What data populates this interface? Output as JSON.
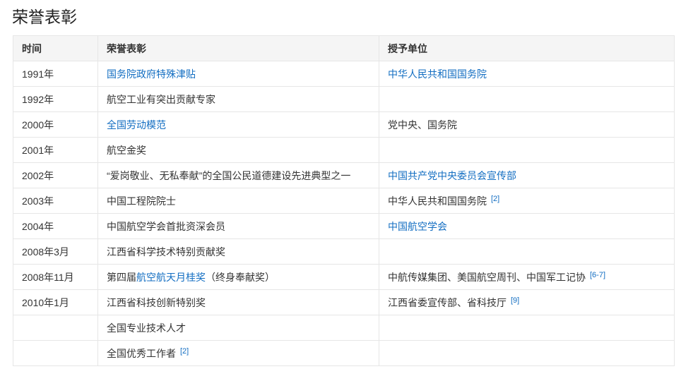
{
  "title": "荣誉表彰",
  "headers": [
    "时间",
    "荣誉表彰",
    "授予单位"
  ],
  "rows": [
    {
      "time": "1991年",
      "honor": [
        {
          "text": "国务院政府特殊津贴",
          "link": true
        }
      ],
      "org": [
        {
          "text": "中华人民共和国国务院",
          "link": true
        }
      ],
      "org_ref": ""
    },
    {
      "time": "1992年",
      "honor": [
        {
          "text": "航空工业有突出贡献专家",
          "link": false
        }
      ],
      "org": [],
      "org_ref": ""
    },
    {
      "time": "2000年",
      "honor": [
        {
          "text": "全国劳动模范",
          "link": true
        }
      ],
      "org": [
        {
          "text": "党中央、国务院",
          "link": false
        }
      ],
      "org_ref": ""
    },
    {
      "time": "2001年",
      "honor": [
        {
          "text": "航空金奖",
          "link": false
        }
      ],
      "org": [],
      "org_ref": ""
    },
    {
      "time": "2002年",
      "honor": [
        {
          "text": "“爱岗敬业、无私奉献”的全国公民道德建设先进典型之一",
          "link": false
        }
      ],
      "org": [
        {
          "text": "中国共产党中央委员会宣传部",
          "link": true
        }
      ],
      "org_ref": ""
    },
    {
      "time": "2003年",
      "honor": [
        {
          "text": "中国工程院院士",
          "link": false
        }
      ],
      "org": [
        {
          "text": "中华人民共和国国务院",
          "link": false
        }
      ],
      "org_ref": "[2]"
    },
    {
      "time": "2004年",
      "honor": [
        {
          "text": "中国航空学会首批资深会员",
          "link": false
        }
      ],
      "org": [
        {
          "text": "中国航空学会",
          "link": true
        }
      ],
      "org_ref": ""
    },
    {
      "time": "2008年3月",
      "honor": [
        {
          "text": "江西省科学技术特别贡献奖",
          "link": false
        }
      ],
      "org": [],
      "org_ref": ""
    },
    {
      "time": "2008年11月",
      "honor": [
        {
          "text": "第四届",
          "link": false
        },
        {
          "text": "航空航天月桂奖",
          "link": true
        },
        {
          "text": "（终身奉献奖）",
          "link": false
        }
      ],
      "org": [
        {
          "text": "中航传媒集团、美国航空周刊、中国军工记协",
          "link": false
        }
      ],
      "org_ref": "[6-7]"
    },
    {
      "time": "2010年1月",
      "honor": [
        {
          "text": "江西省科技创新特别奖",
          "link": false
        }
      ],
      "org": [
        {
          "text": "江西省委宣传部、省科技厅",
          "link": false
        }
      ],
      "org_ref": "[9]"
    },
    {
      "time": "",
      "honor": [
        {
          "text": "全国专业技术人才",
          "link": false
        }
      ],
      "org": [],
      "org_ref": ""
    },
    {
      "time": "",
      "honor": [
        {
          "text": "全国优秀工作者",
          "link": false
        }
      ],
      "org": [],
      "org_ref": "",
      "honor_ref": "[2]"
    }
  ]
}
